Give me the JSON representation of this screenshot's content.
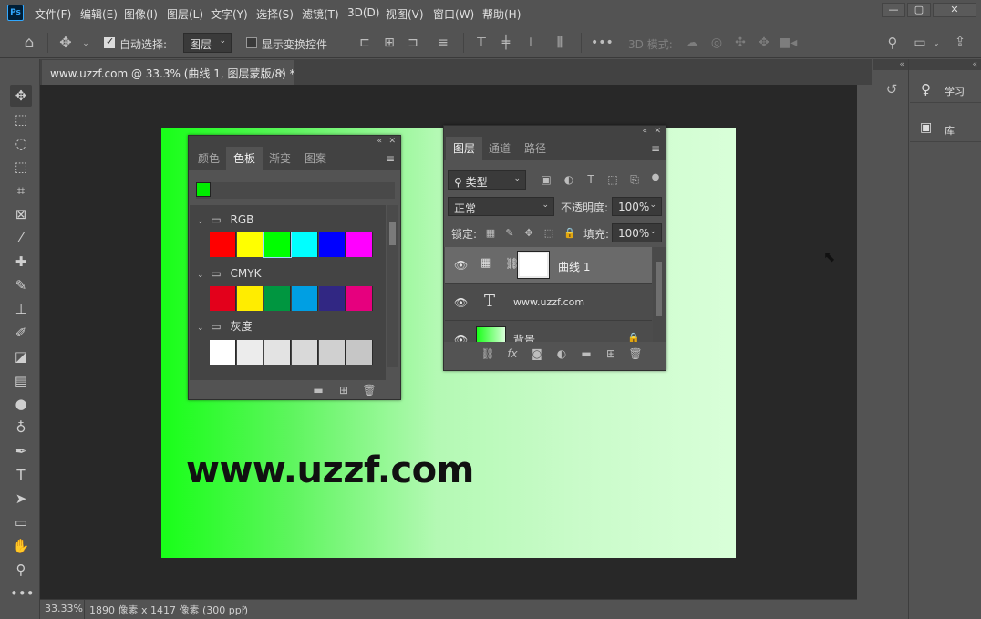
{
  "app": {
    "logo": "Ps",
    "menu": [
      "文件(F)",
      "编辑(E)",
      "图像(I)",
      "图层(L)",
      "文字(Y)",
      "选择(S)",
      "滤镜(T)",
      "3D(D)",
      "视图(V)",
      "窗口(W)",
      "帮助(H)"
    ]
  },
  "options": {
    "auto_select_label": "自动选择:",
    "auto_select_value": "图层",
    "show_transform_label": "显示变换控件",
    "mode_3d_label": "3D 模式:"
  },
  "document": {
    "tab_title": "www.uzzf.com @ 33.3% (曲线 1, 图层蒙版/8) *",
    "canvas_text": "www.uzzf.com",
    "zoom": "33.33%",
    "size_info": "1890 像素 x 1417 像素 (300 ppi)"
  },
  "swatches_panel": {
    "tabs": [
      "颜色",
      "色板",
      "渐变",
      "图案"
    ],
    "active_tab": "色板",
    "current_color": "#00ee00",
    "groups": [
      {
        "name": "RGB",
        "colors": [
          "#ff0000",
          "#ffff00",
          "#00ff00",
          "#00ffff",
          "#0000ff",
          "#ff00ff"
        ]
      },
      {
        "name": "CMYK",
        "colors": [
          "#e3001b",
          "#ffed00",
          "#009640",
          "#009fe3",
          "#312783",
          "#e6007e"
        ]
      },
      {
        "name": "灰度",
        "colors": [
          "#ffffff",
          "#ececec",
          "#e3e3e3",
          "#d9d9d9",
          "#d0d0d0",
          "#c6c6c6"
        ]
      }
    ]
  },
  "layers_panel": {
    "tabs": [
      "图层",
      "通道",
      "路径"
    ],
    "active_tab": "图层",
    "filter_label": "类型",
    "blend_mode": "正常",
    "opacity_label": "不透明度:",
    "opacity_value": "100%",
    "lock_label": "锁定:",
    "fill_label": "填充:",
    "fill_value": "100%",
    "layers": [
      {
        "name": "曲线 1",
        "kind": "adjustment",
        "selected": true
      },
      {
        "name": "www.uzzf.com",
        "kind": "text",
        "selected": false
      },
      {
        "name": "背景",
        "kind": "image",
        "selected": false
      }
    ]
  },
  "right_dock": {
    "learn_label": "学习",
    "libraries_label": "库"
  }
}
